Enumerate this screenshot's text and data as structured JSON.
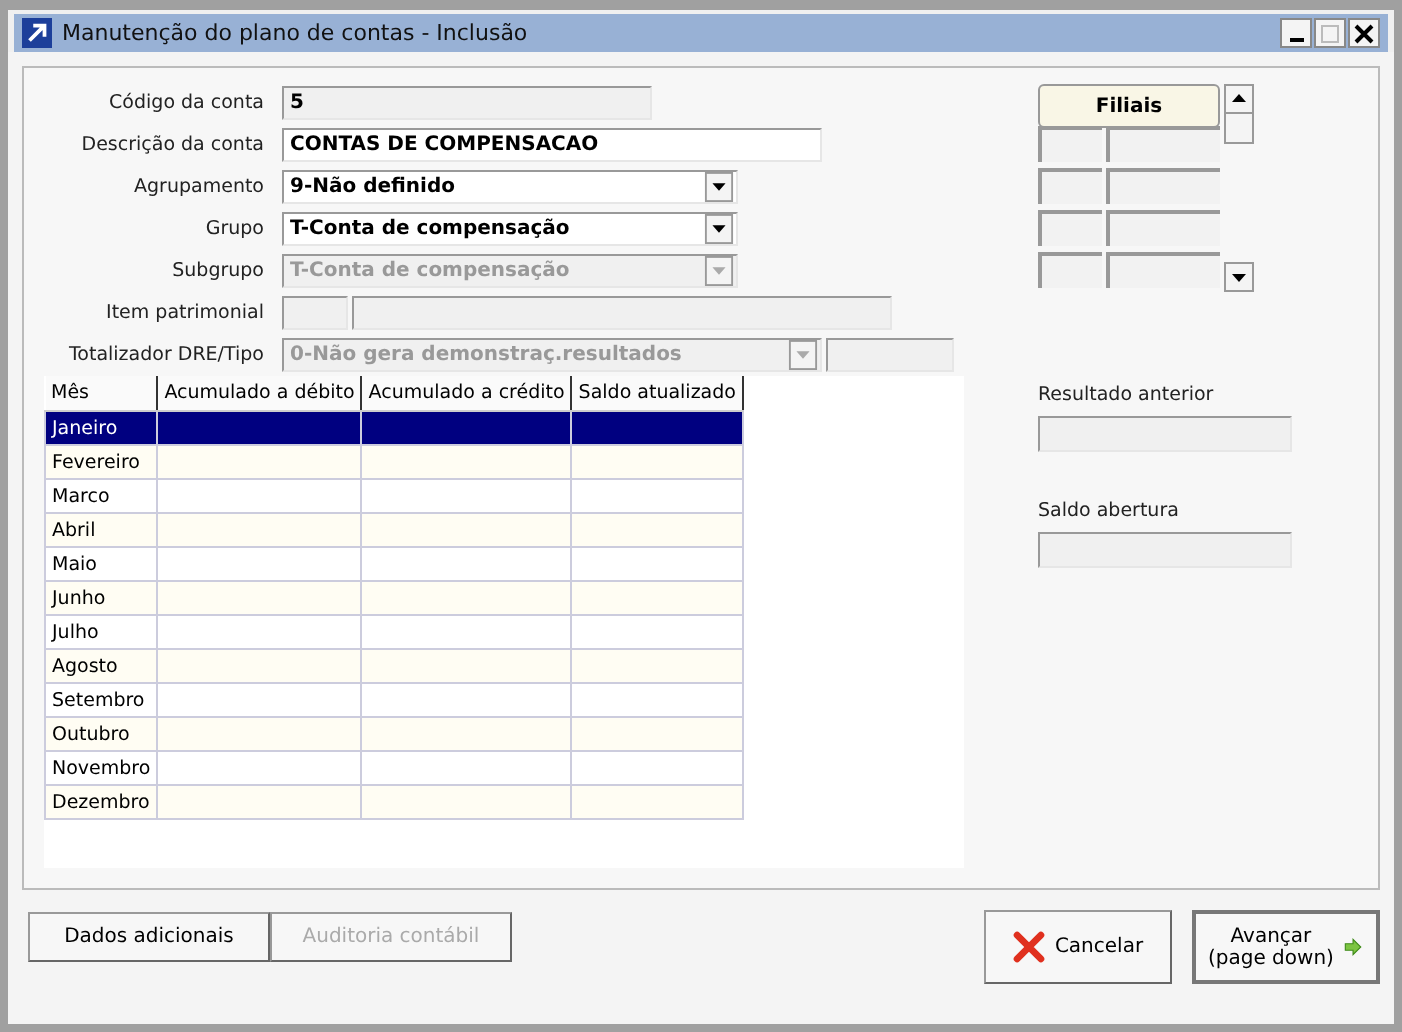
{
  "window": {
    "title": "Manutenção do plano de contas - Inclusão"
  },
  "fields": [
    {
      "label": "Código da conta",
      "kind": "text",
      "value": "5",
      "disabled": true
    },
    {
      "label": "Descrição da conta",
      "kind": "text",
      "value": "CONTAS DE COMPENSACAO",
      "disabled": false
    },
    {
      "label": "Agrupamento",
      "kind": "select",
      "value": "9-Não definido",
      "disabled": false
    },
    {
      "label": "Grupo",
      "kind": "select",
      "value": "T-Conta de compensação",
      "disabled": false
    },
    {
      "label": "Subgrupo",
      "kind": "select",
      "value": "T-Conta de compensação",
      "disabled": true
    },
    {
      "label": "Item patrimonial",
      "kind": "pair",
      "disabled": true
    },
    {
      "label": "Totalizador DRE/Tipo",
      "kind": "select_extra",
      "value": "0-Não gera demonstraç.resultados",
      "disabled": true
    }
  ],
  "table": {
    "columns": [
      "Mês",
      "Acumulado a débito",
      "Acumulado a crédito",
      "Saldo atualizado"
    ],
    "rows": [
      {
        "month": "Janeiro",
        "selected": true
      },
      {
        "month": "Fevereiro",
        "selected": false
      },
      {
        "month": "Marco",
        "selected": false
      },
      {
        "month": "Abril",
        "selected": false
      },
      {
        "month": "Maio",
        "selected": false
      },
      {
        "month": "Junho",
        "selected": false
      },
      {
        "month": "Julho",
        "selected": false
      },
      {
        "month": "Agosto",
        "selected": false
      },
      {
        "month": "Setembro",
        "selected": false
      },
      {
        "month": "Outubro",
        "selected": false
      },
      {
        "month": "Novembro",
        "selected": false
      },
      {
        "month": "Dezembro",
        "selected": false
      }
    ]
  },
  "filiais": {
    "header": "Filiais"
  },
  "side_fields": [
    {
      "label": "Resultado anterior"
    },
    {
      "label": "Saldo abertura"
    }
  ],
  "left_buttons": [
    {
      "label": "Dados adicionais",
      "disabled": false
    },
    {
      "label": "Auditoria contábil",
      "disabled": true
    }
  ],
  "right_buttons": [
    {
      "kind": "cancel",
      "label": "Cancelar"
    },
    {
      "kind": "next",
      "lines": [
        "Avançar",
        "(page down)"
      ]
    }
  ]
}
